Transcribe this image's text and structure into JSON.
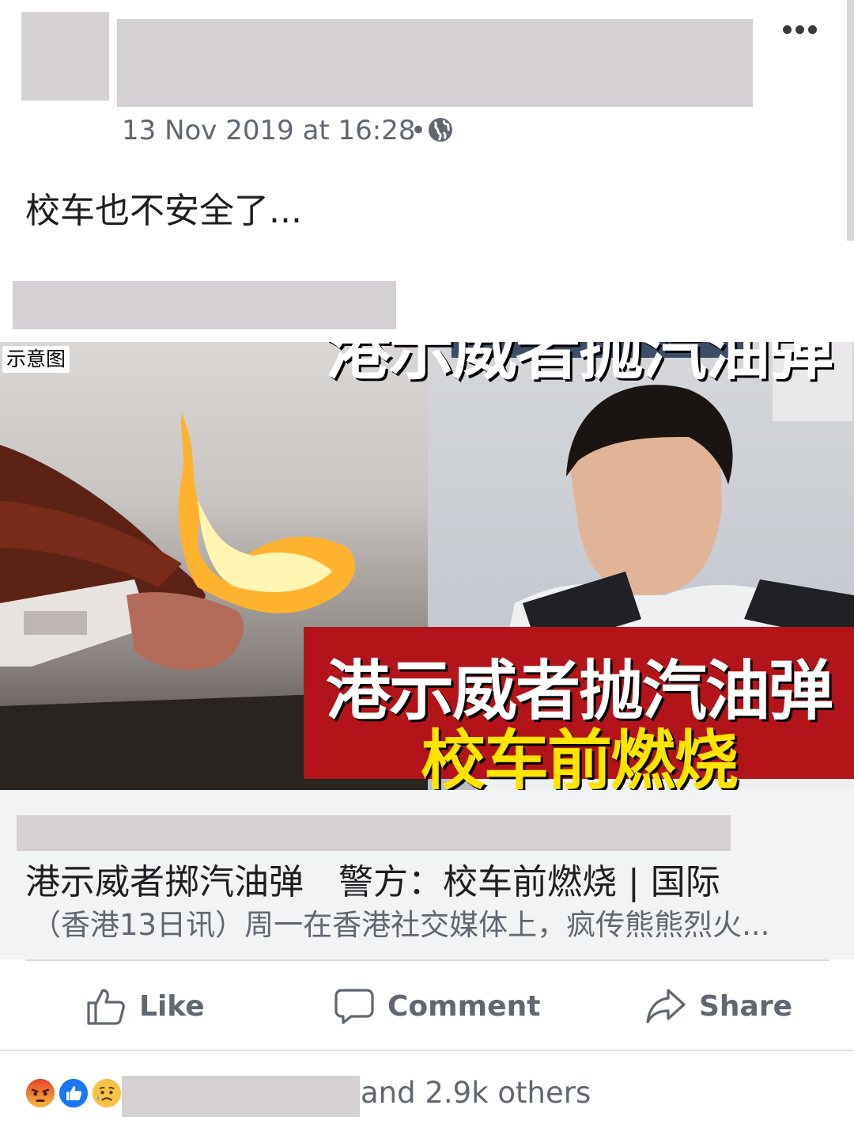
{
  "post": {
    "timestamp": "13 Nov 2019 at 16:28",
    "separator": "•",
    "privacy_icon": "globe-icon",
    "text": "校车也不安全了..."
  },
  "link": {
    "image": {
      "badge": "示意图",
      "headline_line1": "港示威者抛汽油弹",
      "headline_line2": "校车前燃烧"
    },
    "title": "港示威者掷汽油弹　警方：校车前燃烧 | 国际",
    "description": "（香港13日讯）周一在香港社交媒体上，疯传熊熊烈火..."
  },
  "actions": {
    "like": "Like",
    "comment": "Comment",
    "share": "Share"
  },
  "reactions": {
    "icons": [
      "angry-reaction-icon",
      "like-reaction-icon",
      "sad-reaction-icon"
    ],
    "summary": "and 2.9k others"
  },
  "colors": {
    "meta_text": "#606770",
    "redaction": "#d4d0d4",
    "headline_red": "#b2141a",
    "headline_yellow": "#ffe400",
    "like_blue": "#1877f2"
  }
}
